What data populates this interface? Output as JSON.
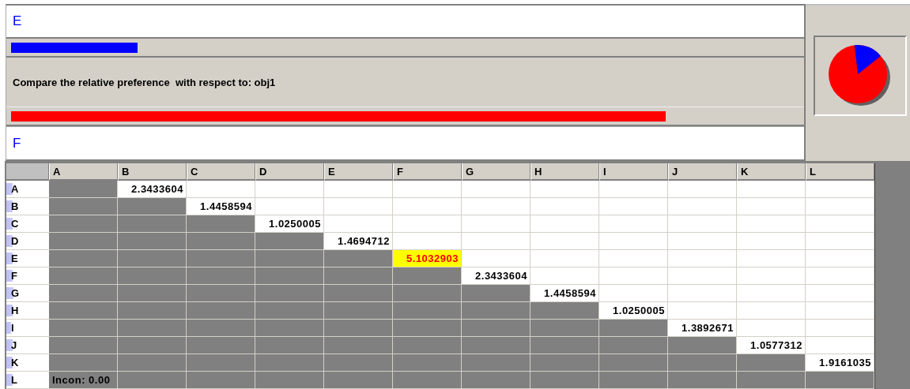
{
  "top_panel": {
    "upper_label": "E",
    "upper_bar": {
      "level": 0.16,
      "color": "#0000ff"
    },
    "prompt": "Compare the relative preference  with respect to: obj1",
    "lower_bar": {
      "level": 0.83,
      "color": "#ff0000"
    },
    "lower_label": "F"
  },
  "matrix": {
    "columns": [
      "A",
      "B",
      "C",
      "D",
      "E",
      "F",
      "G",
      "H",
      "I",
      "J",
      "K",
      "L"
    ],
    "rows": [
      {
        "label": "A",
        "cells": [
          {
            "kind": "shaded"
          },
          {
            "kind": "value",
            "text": "2.3433604",
            "highlighted": false
          },
          {
            "kind": "blank"
          },
          {
            "kind": "blank"
          },
          {
            "kind": "blank"
          },
          {
            "kind": "blank"
          },
          {
            "kind": "blank"
          },
          {
            "kind": "blank"
          },
          {
            "kind": "blank"
          },
          {
            "kind": "blank"
          },
          {
            "kind": "blank"
          },
          {
            "kind": "blank"
          }
        ]
      },
      {
        "label": "B",
        "cells": [
          {
            "kind": "shaded"
          },
          {
            "kind": "shaded"
          },
          {
            "kind": "value",
            "text": "1.4458594",
            "highlighted": false
          },
          {
            "kind": "blank"
          },
          {
            "kind": "blank"
          },
          {
            "kind": "blank"
          },
          {
            "kind": "blank"
          },
          {
            "kind": "blank"
          },
          {
            "kind": "blank"
          },
          {
            "kind": "blank"
          },
          {
            "kind": "blank"
          },
          {
            "kind": "blank"
          }
        ]
      },
      {
        "label": "C",
        "cells": [
          {
            "kind": "shaded"
          },
          {
            "kind": "shaded"
          },
          {
            "kind": "shaded"
          },
          {
            "kind": "value",
            "text": "1.0250005",
            "highlighted": false
          },
          {
            "kind": "blank"
          },
          {
            "kind": "blank"
          },
          {
            "kind": "blank"
          },
          {
            "kind": "blank"
          },
          {
            "kind": "blank"
          },
          {
            "kind": "blank"
          },
          {
            "kind": "blank"
          },
          {
            "kind": "blank"
          }
        ]
      },
      {
        "label": "D",
        "cells": [
          {
            "kind": "shaded"
          },
          {
            "kind": "shaded"
          },
          {
            "kind": "shaded"
          },
          {
            "kind": "shaded"
          },
          {
            "kind": "value",
            "text": "1.4694712",
            "highlighted": false
          },
          {
            "kind": "blank"
          },
          {
            "kind": "blank"
          },
          {
            "kind": "blank"
          },
          {
            "kind": "blank"
          },
          {
            "kind": "blank"
          },
          {
            "kind": "blank"
          },
          {
            "kind": "blank"
          }
        ]
      },
      {
        "label": "E",
        "cells": [
          {
            "kind": "shaded"
          },
          {
            "kind": "shaded"
          },
          {
            "kind": "shaded"
          },
          {
            "kind": "shaded"
          },
          {
            "kind": "shaded"
          },
          {
            "kind": "value",
            "text": "5.1032903",
            "highlighted": true
          },
          {
            "kind": "blank"
          },
          {
            "kind": "blank"
          },
          {
            "kind": "blank"
          },
          {
            "kind": "blank"
          },
          {
            "kind": "blank"
          },
          {
            "kind": "blank"
          }
        ]
      },
      {
        "label": "F",
        "cells": [
          {
            "kind": "shaded"
          },
          {
            "kind": "shaded"
          },
          {
            "kind": "shaded"
          },
          {
            "kind": "shaded"
          },
          {
            "kind": "shaded"
          },
          {
            "kind": "shaded"
          },
          {
            "kind": "value",
            "text": "2.3433604",
            "highlighted": false
          },
          {
            "kind": "blank"
          },
          {
            "kind": "blank"
          },
          {
            "kind": "blank"
          },
          {
            "kind": "blank"
          },
          {
            "kind": "blank"
          }
        ]
      },
      {
        "label": "G",
        "cells": [
          {
            "kind": "shaded"
          },
          {
            "kind": "shaded"
          },
          {
            "kind": "shaded"
          },
          {
            "kind": "shaded"
          },
          {
            "kind": "shaded"
          },
          {
            "kind": "shaded"
          },
          {
            "kind": "shaded"
          },
          {
            "kind": "value",
            "text": "1.4458594",
            "highlighted": false
          },
          {
            "kind": "blank"
          },
          {
            "kind": "blank"
          },
          {
            "kind": "blank"
          },
          {
            "kind": "blank"
          }
        ]
      },
      {
        "label": "H",
        "cells": [
          {
            "kind": "shaded"
          },
          {
            "kind": "shaded"
          },
          {
            "kind": "shaded"
          },
          {
            "kind": "shaded"
          },
          {
            "kind": "shaded"
          },
          {
            "kind": "shaded"
          },
          {
            "kind": "shaded"
          },
          {
            "kind": "shaded"
          },
          {
            "kind": "value",
            "text": "1.0250005",
            "highlighted": false
          },
          {
            "kind": "blank"
          },
          {
            "kind": "blank"
          },
          {
            "kind": "blank"
          }
        ]
      },
      {
        "label": "I",
        "cells": [
          {
            "kind": "shaded"
          },
          {
            "kind": "shaded"
          },
          {
            "kind": "shaded"
          },
          {
            "kind": "shaded"
          },
          {
            "kind": "shaded"
          },
          {
            "kind": "shaded"
          },
          {
            "kind": "shaded"
          },
          {
            "kind": "shaded"
          },
          {
            "kind": "shaded"
          },
          {
            "kind": "value",
            "text": "1.3892671",
            "highlighted": false
          },
          {
            "kind": "blank"
          },
          {
            "kind": "blank"
          }
        ]
      },
      {
        "label": "J",
        "cells": [
          {
            "kind": "shaded"
          },
          {
            "kind": "shaded"
          },
          {
            "kind": "shaded"
          },
          {
            "kind": "shaded"
          },
          {
            "kind": "shaded"
          },
          {
            "kind": "shaded"
          },
          {
            "kind": "shaded"
          },
          {
            "kind": "shaded"
          },
          {
            "kind": "shaded"
          },
          {
            "kind": "shaded"
          },
          {
            "kind": "value",
            "text": "1.0577312",
            "highlighted": false
          },
          {
            "kind": "blank"
          }
        ]
      },
      {
        "label": "K",
        "cells": [
          {
            "kind": "shaded"
          },
          {
            "kind": "shaded"
          },
          {
            "kind": "shaded"
          },
          {
            "kind": "shaded"
          },
          {
            "kind": "shaded"
          },
          {
            "kind": "shaded"
          },
          {
            "kind": "shaded"
          },
          {
            "kind": "shaded"
          },
          {
            "kind": "shaded"
          },
          {
            "kind": "shaded"
          },
          {
            "kind": "shaded"
          },
          {
            "kind": "value",
            "text": "1.9161035",
            "highlighted": false
          }
        ]
      },
      {
        "label": "L",
        "cells": [
          {
            "kind": "shaded",
            "text": "Incon: 0.00"
          },
          {
            "kind": "shaded"
          },
          {
            "kind": "shaded"
          },
          {
            "kind": "shaded"
          },
          {
            "kind": "shaded"
          },
          {
            "kind": "shaded"
          },
          {
            "kind": "shaded"
          },
          {
            "kind": "shaded"
          },
          {
            "kind": "shaded"
          },
          {
            "kind": "shaded"
          },
          {
            "kind": "shaded"
          },
          {
            "kind": "shaded"
          }
        ]
      }
    ]
  }
}
